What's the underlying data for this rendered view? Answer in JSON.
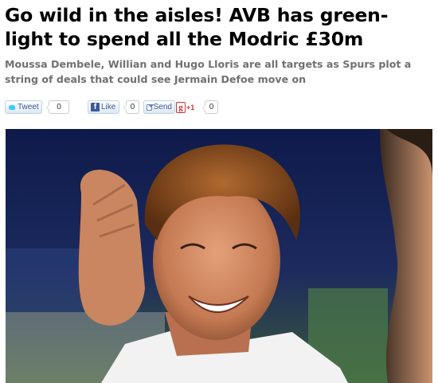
{
  "article": {
    "headline": "Go wild in the aisles! AVB has green-light to spend all the Modric £30m",
    "standfirst": "Moussa Dembele, Willian and Hugo Lloris are all targets as Spurs plot a string of deals that could see Jermain Defoe move on"
  },
  "share": {
    "tweet": {
      "label": "Tweet",
      "count": "0",
      "icon": "twitter-bird-icon"
    },
    "facebook": {
      "label": "Like",
      "count": "0",
      "icon": "facebook-f-icon"
    },
    "send": {
      "label": "Send",
      "icon": "envelope-icon"
    },
    "gplus": {
      "label": "+1",
      "count": "0",
      "icon": "google-plus-icon"
    }
  },
  "photo": {
    "subject_icon": "news-photo",
    "colors": {
      "background": "#0e1a4a",
      "grass": "#3b6b3a",
      "skin": "#d08a62",
      "hair": "#8a4a1c"
    }
  }
}
